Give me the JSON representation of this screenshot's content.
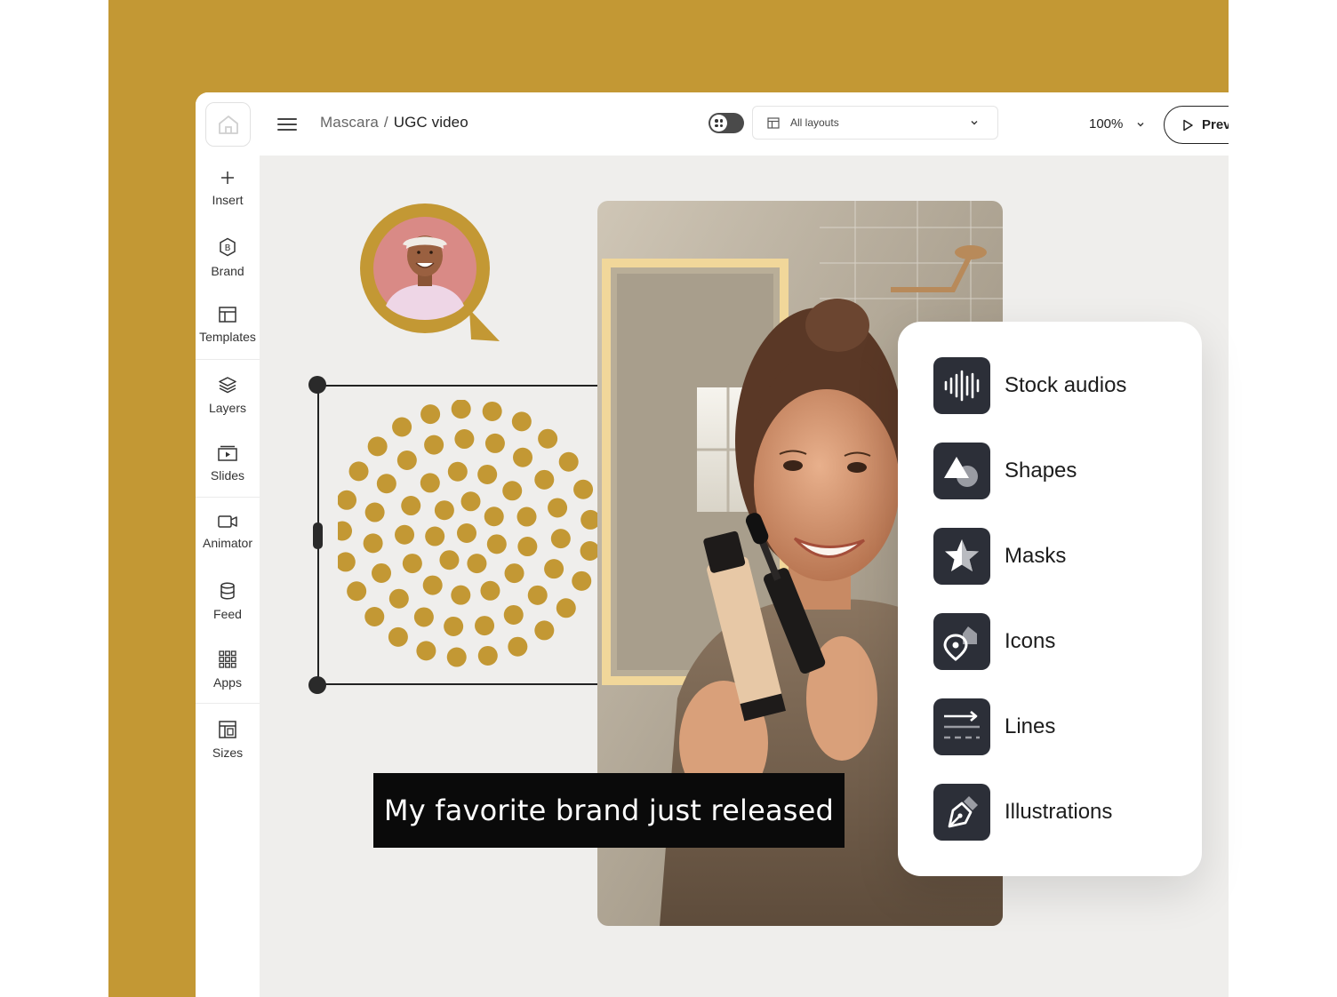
{
  "colors": {
    "accent": "#c39834",
    "panel_icon_bg": "#2c2f38",
    "caption_bg": "#0a0a0a"
  },
  "topbar": {
    "home_icon": "home-icon",
    "menu_icon": "hamburger-icon",
    "breadcrumb": {
      "parent": "Mascara",
      "separator": "/",
      "current": "UGC video"
    },
    "layouts_select": {
      "value": "All layouts"
    },
    "zoom": "100%",
    "preview_label": "Prev"
  },
  "sidebar": {
    "items": [
      {
        "label": "Insert",
        "icon": "plus-icon"
      },
      {
        "label": "Brand",
        "icon": "brand-hexagon-icon"
      },
      {
        "label": "Templates",
        "icon": "templates-icon"
      },
      {
        "label": "Layers",
        "icon": "layers-icon"
      },
      {
        "label": "Slides",
        "icon": "slides-icon"
      },
      {
        "label": "Animator",
        "icon": "video-camera-icon"
      },
      {
        "label": "Feed",
        "icon": "database-icon"
      },
      {
        "label": "Apps",
        "icon": "grid-icon"
      },
      {
        "label": "Sizes",
        "icon": "sizes-icon"
      }
    ]
  },
  "canvas": {
    "caption": "My favorite brand just released"
  },
  "panel": {
    "items": [
      {
        "label": "Stock audios",
        "icon": "audio-wave-icon"
      },
      {
        "label": "Shapes",
        "icon": "shapes-icon"
      },
      {
        "label": "Masks",
        "icon": "star-mask-icon"
      },
      {
        "label": "Icons",
        "icon": "location-pin-icon"
      },
      {
        "label": "Lines",
        "icon": "lines-icon"
      },
      {
        "label": "Illustrations",
        "icon": "pen-nib-icon"
      }
    ]
  }
}
